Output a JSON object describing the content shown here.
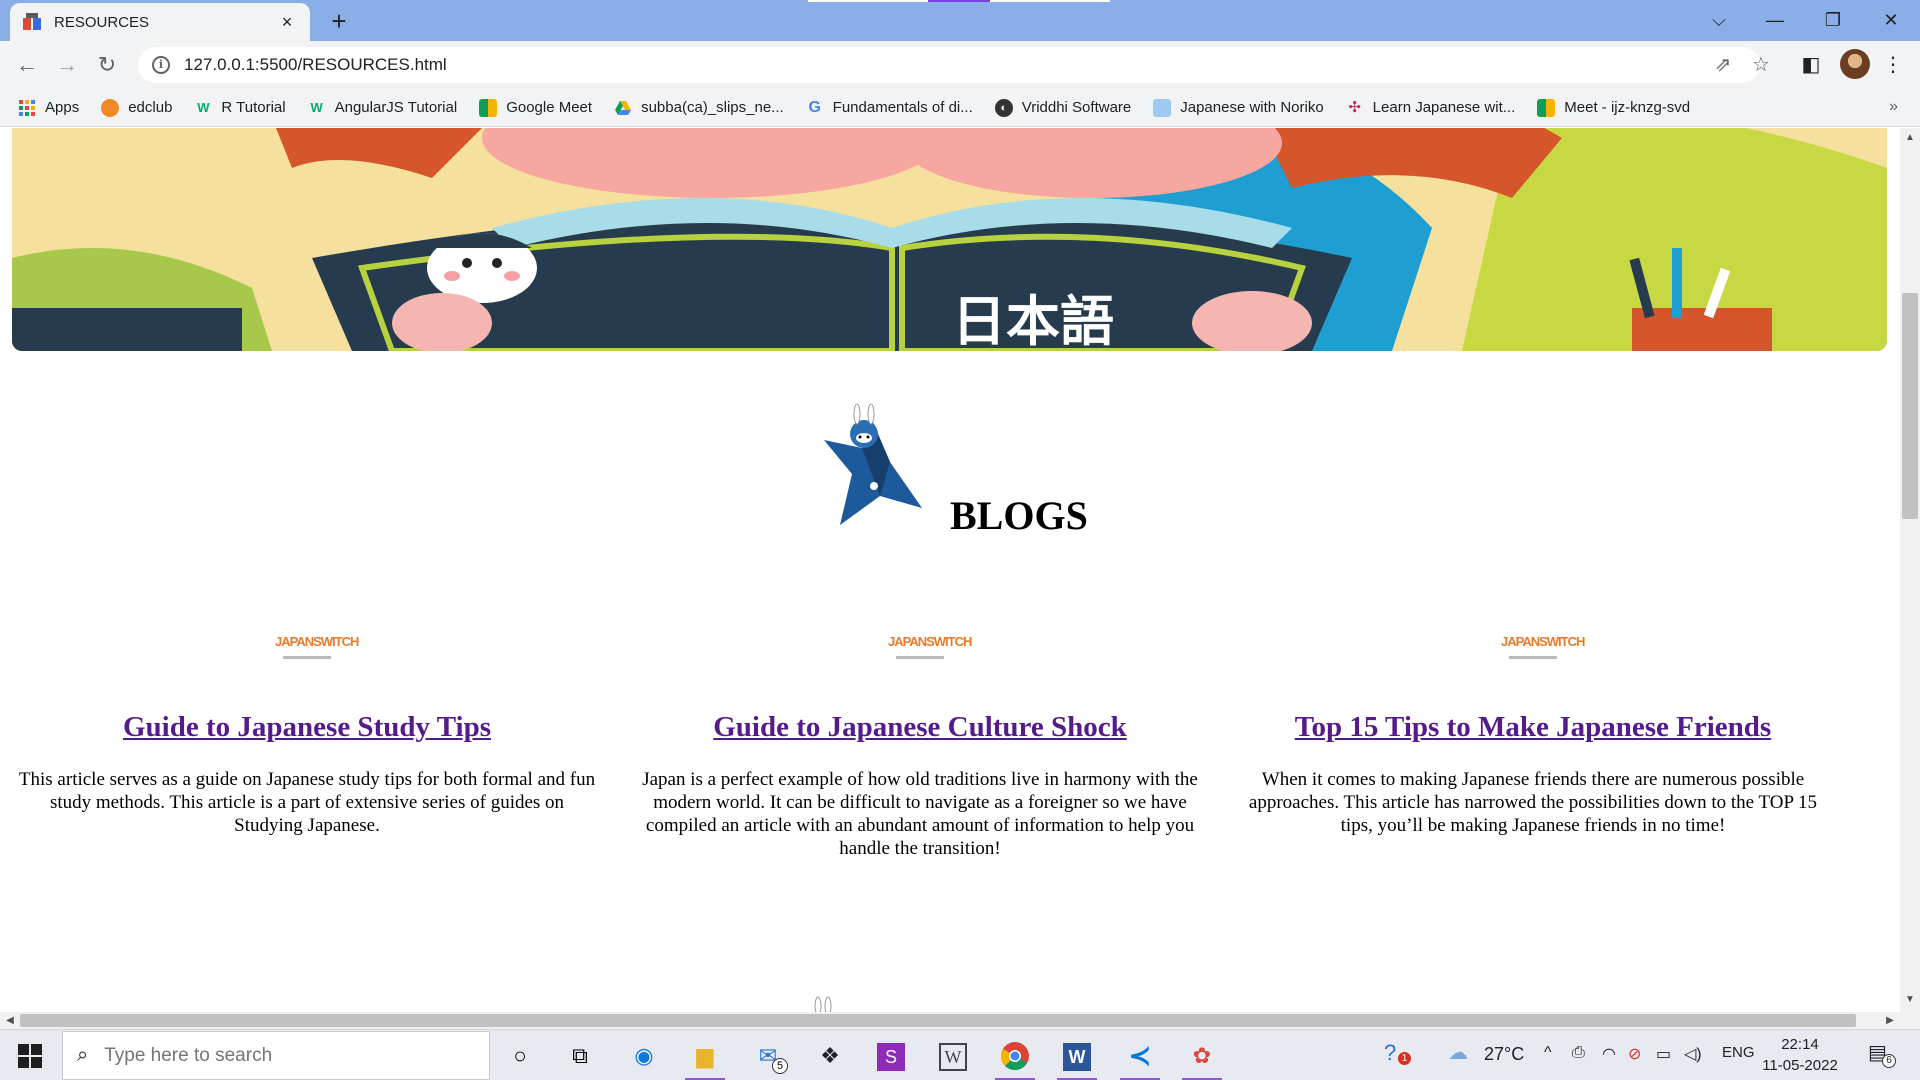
{
  "browser": {
    "tab_title": "RESOURCES",
    "tab_close": "×",
    "new_tab": "+",
    "url": "127.0.0.1:5500/RESOURCES.html",
    "bookmarks": [
      {
        "label": "Apps",
        "icon": "apps-grid-icon"
      },
      {
        "label": "edclub",
        "icon": "edclub-icon"
      },
      {
        "label": "R Tutorial",
        "icon": "w3schools-icon"
      },
      {
        "label": "AngularJS Tutorial",
        "icon": "w3schools-icon"
      },
      {
        "label": "Google Meet",
        "icon": "google-meet-icon"
      },
      {
        "label": "subba(ca)_slips_ne...",
        "icon": "google-drive-icon"
      },
      {
        "label": "Fundamentals of di...",
        "icon": "google-icon"
      },
      {
        "label": "Vriddhi Software",
        "icon": "globe-icon"
      },
      {
        "label": "Japanese with Noriko",
        "icon": "page-icon"
      },
      {
        "label": "Learn Japanese wit...",
        "icon": "slack-icon"
      },
      {
        "label": "Meet - ijz-knzg-svd",
        "icon": "google-meet-icon"
      }
    ],
    "bookmarks_more": "»"
  },
  "page": {
    "section_title": "BLOGS",
    "cards": [
      {
        "logo_text": "JAPANSWITCH",
        "title": "Guide to Japanese Study Tips",
        "description": "This article serves as a guide on Japanese study tips for both formal and fun study methods. This article is a part of extensive series of guides on Studying Japanese."
      },
      {
        "logo_text": "JAPANSWITCH",
        "title": "Guide to Japanese Culture Shock",
        "description": "Japan is a perfect example of how old traditions live in harmony with the modern world. It can be difficult to navigate as a foreigner so we have compiled an article with an abundant amount of information to help you handle the transition!"
      },
      {
        "logo_text": "JAPANSWITCH",
        "title": "Top 15 Tips to Make Japanese Friends",
        "description": "When it comes to making Japanese friends there are numerous possible approaches. This article has narrowed the possibilities down to the TOP 15 tips, you’ll be making Japanese friends in no time!"
      }
    ],
    "hero_text": "日本語"
  },
  "taskbar": {
    "search_placeholder": "Type here to search",
    "mail_badge": "5",
    "help_badge": "1",
    "weather": "27°C",
    "language": "ENG",
    "time": "22:14",
    "date": "11-05-2022",
    "notifications": "6"
  },
  "colors": {
    "tabstrip": "#8aaee8",
    "link_visited": "#551a8b"
  }
}
